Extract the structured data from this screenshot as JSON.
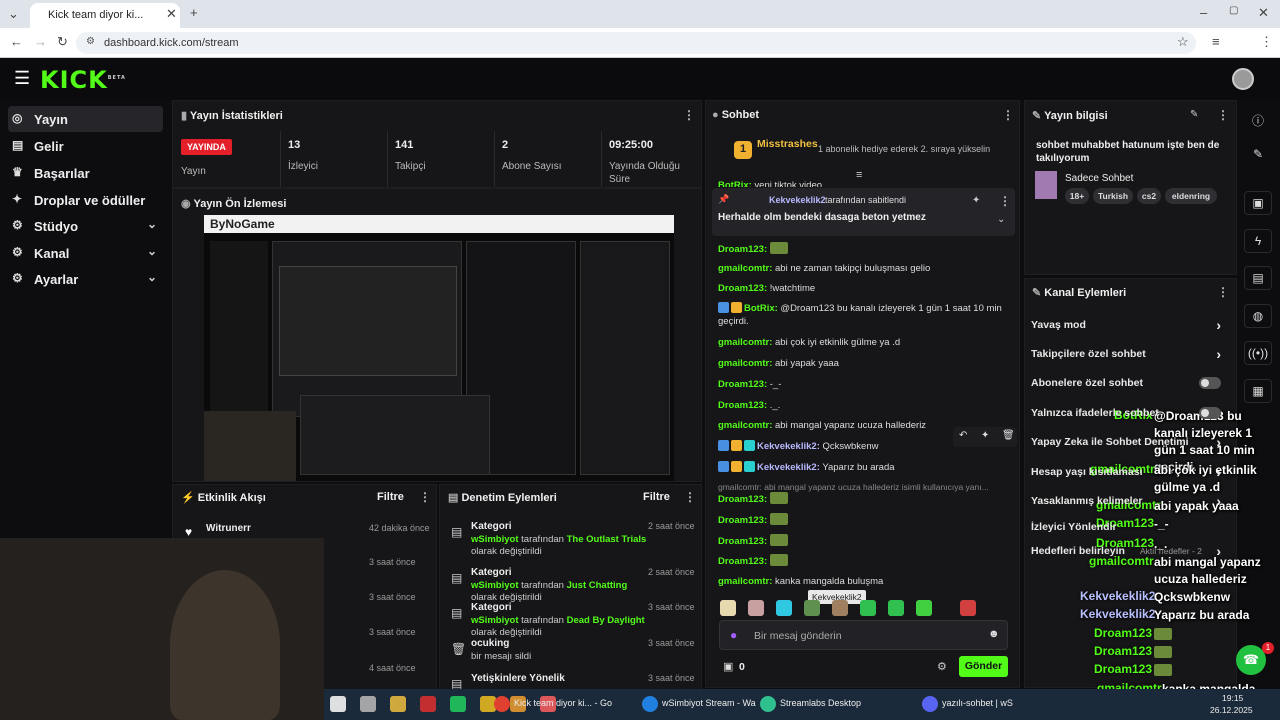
{
  "browser": {
    "tab_title": "Kick team diyor ki...",
    "url": "dashboard.kick.com/stream"
  },
  "colors": {
    "accent": "#53fc18",
    "live": "#e3202a",
    "panel": "#161618",
    "background": "#0d0d0f"
  },
  "header": {
    "logo": "KICK",
    "beta": "BETA"
  },
  "sidebar": {
    "items": [
      {
        "label": "Yayın",
        "icon": "stream-icon"
      },
      {
        "label": "Gelir",
        "icon": "revenue-icon"
      },
      {
        "label": "Başarılar",
        "icon": "trophy-icon"
      },
      {
        "label": "Droplar ve ödüller",
        "icon": "gift-icon"
      },
      {
        "label": "Stüdyo",
        "icon": "studio-icon"
      },
      {
        "label": "Kanal",
        "icon": "channel-icon"
      },
      {
        "label": "Ayarlar",
        "icon": "gear-icon"
      }
    ]
  },
  "stats": {
    "title": "Yayın İstatistikleri",
    "live_badge": "YAYINDA",
    "live_label": "Yayın",
    "items": [
      {
        "value": "13",
        "label": "İzleyici"
      },
      {
        "value": "141",
        "label": "Takipçi"
      },
      {
        "value": "2",
        "label": "Abone Sayısı"
      },
      {
        "value": "09:25:00",
        "label": "Yayında Olduğu Süre"
      }
    ]
  },
  "preview": {
    "title": "Yayın Ön İzlemesi",
    "brand": "ByNoGame"
  },
  "activity": {
    "title": "Etkinlik Akışı",
    "filter": "Filtre",
    "items": [
      {
        "name": "Witrunerr",
        "time": "42 dakika önce"
      },
      {
        "name": "",
        "time": "3 saat önce"
      },
      {
        "name": "",
        "time": "3 saat önce"
      },
      {
        "name": "",
        "time": "3 saat önce"
      },
      {
        "name": "",
        "time": "4 saat önce"
      }
    ]
  },
  "moderation": {
    "title": "Denetim Eylemleri",
    "filter": "Filtre",
    "items": [
      {
        "head": "Kategori",
        "time": "2 saat önce",
        "user": "wSimbiyot",
        "mid": "tarafından",
        "game": "The Outlast Trials",
        "tail": "olarak değiştirildi"
      },
      {
        "head": "Kategori",
        "time": "2 saat önce",
        "user": "wSimbiyot",
        "mid": "tarafından",
        "game": "Just Chatting",
        "tail": "olarak değiştirildi"
      },
      {
        "head": "Kategori",
        "time": "3 saat önce",
        "user": "wSimbiyot",
        "mid": "tarafından",
        "game": "Dead By Daylight",
        "tail": "olarak değiştirildi"
      },
      {
        "head": "ocuking",
        "time": "3 saat önce",
        "user": "",
        "mid": "bir mesajı sildi",
        "game": "",
        "tail": ""
      },
      {
        "head": "Yetişkinlere Yönelik",
        "time": "3 saat önce",
        "user": "",
        "mid": "",
        "game": "",
        "tail": ""
      }
    ]
  },
  "chat": {
    "title": "Sohbet",
    "top_gifter": "Misstrashes",
    "gifter_rank": "1",
    "gift_note": "1 abonelik hediye ederek 2. sıraya yükselin",
    "pinned_by": "Kekvekeklik2",
    "pinned_suffix": "tarafından sabitlendi",
    "pinned_text": "Herhalde olm bendeki dasaga beton yetmez",
    "peek_user": "BotRix:",
    "peek_text": "yeni tiktok video",
    "messages": [
      {
        "user": "Droam123:",
        "text": "",
        "kind": "green"
      },
      {
        "user": "gmailcomtr:",
        "text": "abi ne zaman takipçi buluşması gelio",
        "kind": "green"
      },
      {
        "user": "Droam123:",
        "text": "!watchtime",
        "kind": "green"
      },
      {
        "user": "BotRix:",
        "text": "@Droam123 bu kanalı izleyerek 1 gün 1 saat 10 min geçirdi.",
        "kind": "green"
      },
      {
        "user": "gmailcomtr:",
        "text": "abi çok iyi etkinlik gülme ya .d",
        "kind": "green"
      },
      {
        "user": "gmailcomtr:",
        "text": "abi yapak yaaa",
        "kind": "green"
      },
      {
        "user": "Droam123:",
        "text": "-_-",
        "kind": "green"
      },
      {
        "user": "Droam123:",
        "text": "._.",
        "kind": "green"
      },
      {
        "user": "gmailcomtr:",
        "text": "abi mangal yapanz ucuza hallederiz",
        "kind": "green"
      },
      {
        "user": "Kekvekeklik2:",
        "text": "Qckswbkenw",
        "kind": "k"
      },
      {
        "user": "Kekvekeklik2:",
        "text": "Yaparız bu arada",
        "kind": "k"
      },
      {
        "user": "",
        "text": "gmailcomtr: abi mangal yapanz ucuza hallederiz isimli kullanıcıya yanı...",
        "kind": "reply"
      },
      {
        "user": "Droam123:",
        "text": "",
        "kind": "green"
      },
      {
        "user": "Droam123:",
        "text": "",
        "kind": "green"
      },
      {
        "user": "Droam123:",
        "text": "",
        "kind": "green"
      },
      {
        "user": "Droam123:",
        "text": "",
        "kind": "green"
      },
      {
        "user": "gmailcomtr:",
        "text": "kanka mangalda buluşma",
        "kind": "green"
      }
    ],
    "tooltip": "Kekvekeklik2",
    "input_placeholder": "Bir mesaj gönderin",
    "points": "0",
    "send": "Gönder"
  },
  "info": {
    "title": "Yayın bilgisi",
    "stream_title": "sohbet muhabbet hatunum işte ben de takılıyorum",
    "category": "Sadece Sohbet",
    "tags": [
      "18+",
      "Turkish",
      "cs2",
      "eldenring"
    ]
  },
  "actions": {
    "title": "Kanal Eylemleri",
    "items": [
      {
        "label": "Yavaş mod",
        "control": "chevron"
      },
      {
        "label": "Takipçilere özel sohbet",
        "control": "chevron"
      },
      {
        "label": "Abonelere özel sohbet",
        "control": "toggle"
      },
      {
        "label": "Yalnızca ifadelerle sohbet",
        "control": "toggle"
      },
      {
        "label": "Yapay Zeka ile Sohbet Denetimi",
        "control": "chevron"
      },
      {
        "label": "Hesap yaşı kısıtlaması",
        "control": "chevron"
      },
      {
        "label": "Yasaklanmış kelimeler",
        "control": "chevron"
      },
      {
        "label": "İzleyici Yönlendir",
        "control": ""
      },
      {
        "label": "Hedefleri belirleyin",
        "control": "chevron"
      }
    ],
    "goal_note": "Aktif hedefler - 2"
  },
  "overlay": {
    "lines": [
      {
        "user": "BotRix",
        "text": "@Droam123 bu kanalı izleyerek 1 gün 1 saat 10 min geçirdi.",
        "kind": "green"
      },
      {
        "user": "gmailcomtr",
        "text": "abi çok iyi etkinlik gülme ya .d",
        "kind": "green"
      },
      {
        "user": "gmailcomtr",
        "text": "abi yapak yaaa",
        "kind": "green"
      },
      {
        "user": "Droam123",
        "text": "-_-",
        "kind": "green"
      },
      {
        "user": "Droam123",
        "text": "._.",
        "kind": "green"
      },
      {
        "user": "gmailcomtr",
        "text": "abi mangal yapanz ucuza hallederiz",
        "kind": "green"
      },
      {
        "user": "Kekvekeklik2",
        "text": "Qckswbkenw",
        "kind": "k"
      },
      {
        "user": "Kekvekeklik2",
        "text": "Yaparız bu arada",
        "kind": "k"
      },
      {
        "user": "Droam123",
        "text": "",
        "kind": "green"
      },
      {
        "user": "Droam123",
        "text": "",
        "kind": "green"
      },
      {
        "user": "Droam123",
        "text": "",
        "kind": "green"
      },
      {
        "user": "gmailcomtr",
        "text": "kanka mangalda buluşma",
        "kind": "green"
      }
    ]
  },
  "taskbar": {
    "apps": [
      {
        "label": "Kick team diyor ki... - Go",
        "icon": "chrome-icon"
      },
      {
        "label": "wSimbiyot Stream - Wa",
        "icon": "edge-icon"
      },
      {
        "label": "Streamlabs Desktop",
        "icon": "streamlabs-icon"
      },
      {
        "label": "yazılı-sohbet | wS",
        "icon": "discord-icon"
      }
    ],
    "time": "19:15",
    "date": "26.12.2025",
    "notif": "1"
  }
}
